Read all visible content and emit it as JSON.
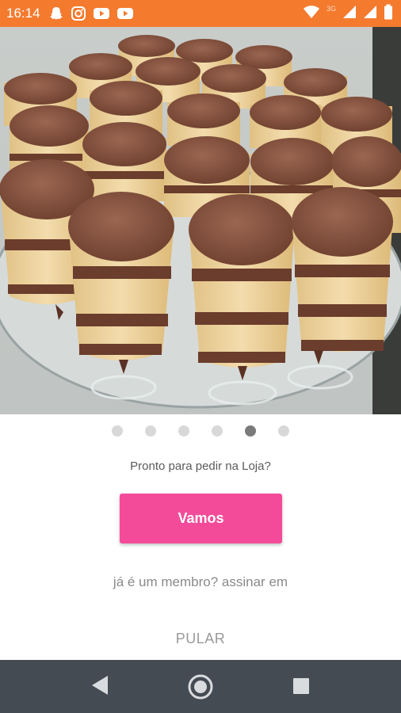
{
  "status_bar": {
    "time": "16:14",
    "network_label": "3G",
    "background": "#f47a2e",
    "left_icons": [
      "snapchat-icon",
      "instagram-icon",
      "youtube-icon",
      "youtube-icon"
    ],
    "right_icons": [
      "wifi-icon",
      "signal-icon",
      "signal-icon",
      "battery-icon"
    ]
  },
  "onboarding": {
    "image": "chocolate-dessert-cups-photo",
    "pager": {
      "total": 6,
      "active_index": 4
    },
    "prompt_text": "Pronto para pedir na Loja?",
    "primary_button": {
      "label": "Vamos",
      "color": "#f34b9a"
    },
    "signin_link": "já é um membro? assinar em",
    "skip_label": "PULAR"
  },
  "nav_bar": {
    "background": "#444b52",
    "buttons": [
      "back-icon",
      "home-icon",
      "recents-icon"
    ]
  }
}
